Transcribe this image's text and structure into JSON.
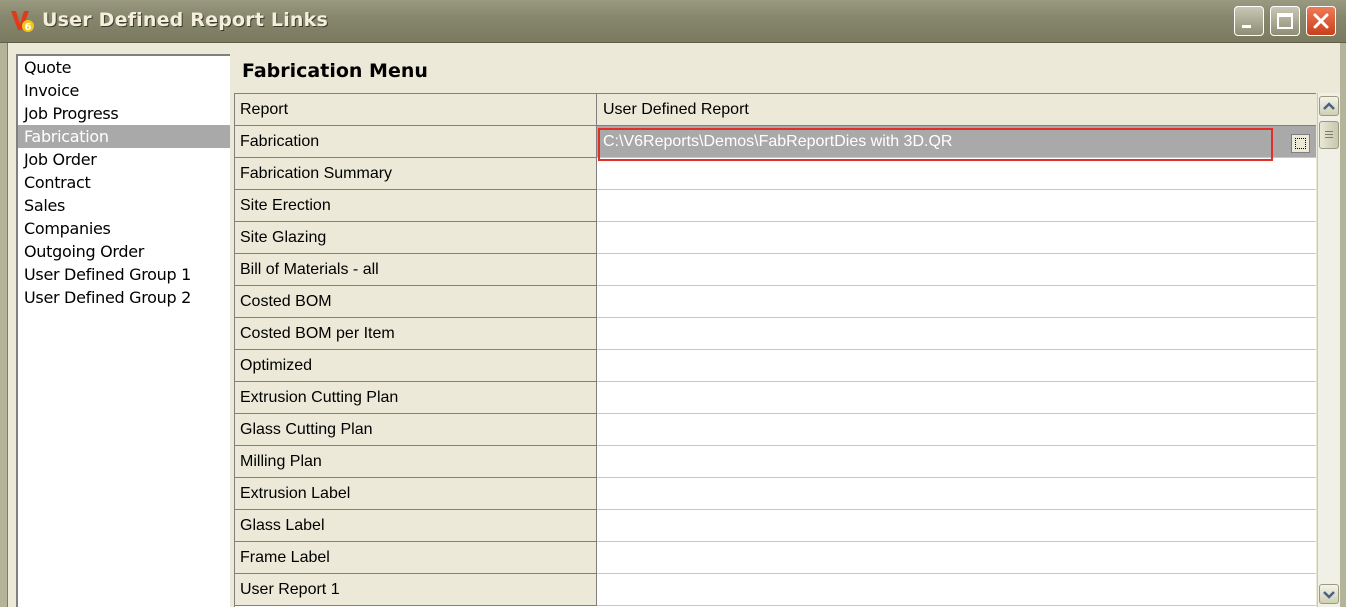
{
  "window": {
    "title": "User Defined Report Links"
  },
  "sidebar": {
    "items": [
      {
        "label": "Quote"
      },
      {
        "label": "Invoice"
      },
      {
        "label": "Job Progress"
      },
      {
        "label": "Fabrication",
        "selected": true
      },
      {
        "label": "Job Order"
      },
      {
        "label": "Contract"
      },
      {
        "label": "Sales"
      },
      {
        "label": "Companies"
      },
      {
        "label": "Outgoing Order"
      },
      {
        "label": "User Defined Group 1"
      },
      {
        "label": "User Defined Group 2"
      }
    ]
  },
  "main": {
    "title": "Fabrication Menu",
    "grid": {
      "headers": {
        "report": "Report",
        "user_report": "User Defined Report"
      },
      "rows": [
        {
          "report": "Fabrication",
          "user_report": "C:\\V6Reports\\Demos\\FabReportDies with 3D.QR"
        },
        {
          "report": "Fabrication Summary",
          "user_report": ""
        },
        {
          "report": "Site Erection",
          "user_report": ""
        },
        {
          "report": "Site Glazing",
          "user_report": ""
        },
        {
          "report": "Bill of Materials - all",
          "user_report": ""
        },
        {
          "report": "Costed BOM",
          "user_report": ""
        },
        {
          "report": "Costed BOM per Item",
          "user_report": ""
        },
        {
          "report": "Optimized",
          "user_report": ""
        },
        {
          "report": "Extrusion Cutting Plan",
          "user_report": ""
        },
        {
          "report": "Glass Cutting Plan",
          "user_report": ""
        },
        {
          "report": "Milling Plan",
          "user_report": ""
        },
        {
          "report": "Extrusion Label",
          "user_report": ""
        },
        {
          "report": "Glass Label",
          "user_report": ""
        },
        {
          "report": "Frame Label",
          "user_report": ""
        },
        {
          "report": "User Report 1",
          "user_report": ""
        }
      ]
    }
  },
  "icons": {
    "app": "v6-app-icon",
    "minimize": "minimize-icon",
    "maximize": "maximize-icon",
    "close": "close-icon",
    "browse": "ellipsis-icon",
    "scroll_up": "scroll-up-icon",
    "scroll_down": "scroll-down-icon"
  },
  "colors": {
    "titlebar": "#87876d",
    "selection": "#a9a9a9",
    "active_outline": "#e0302a",
    "close_button": "#c8401c"
  }
}
